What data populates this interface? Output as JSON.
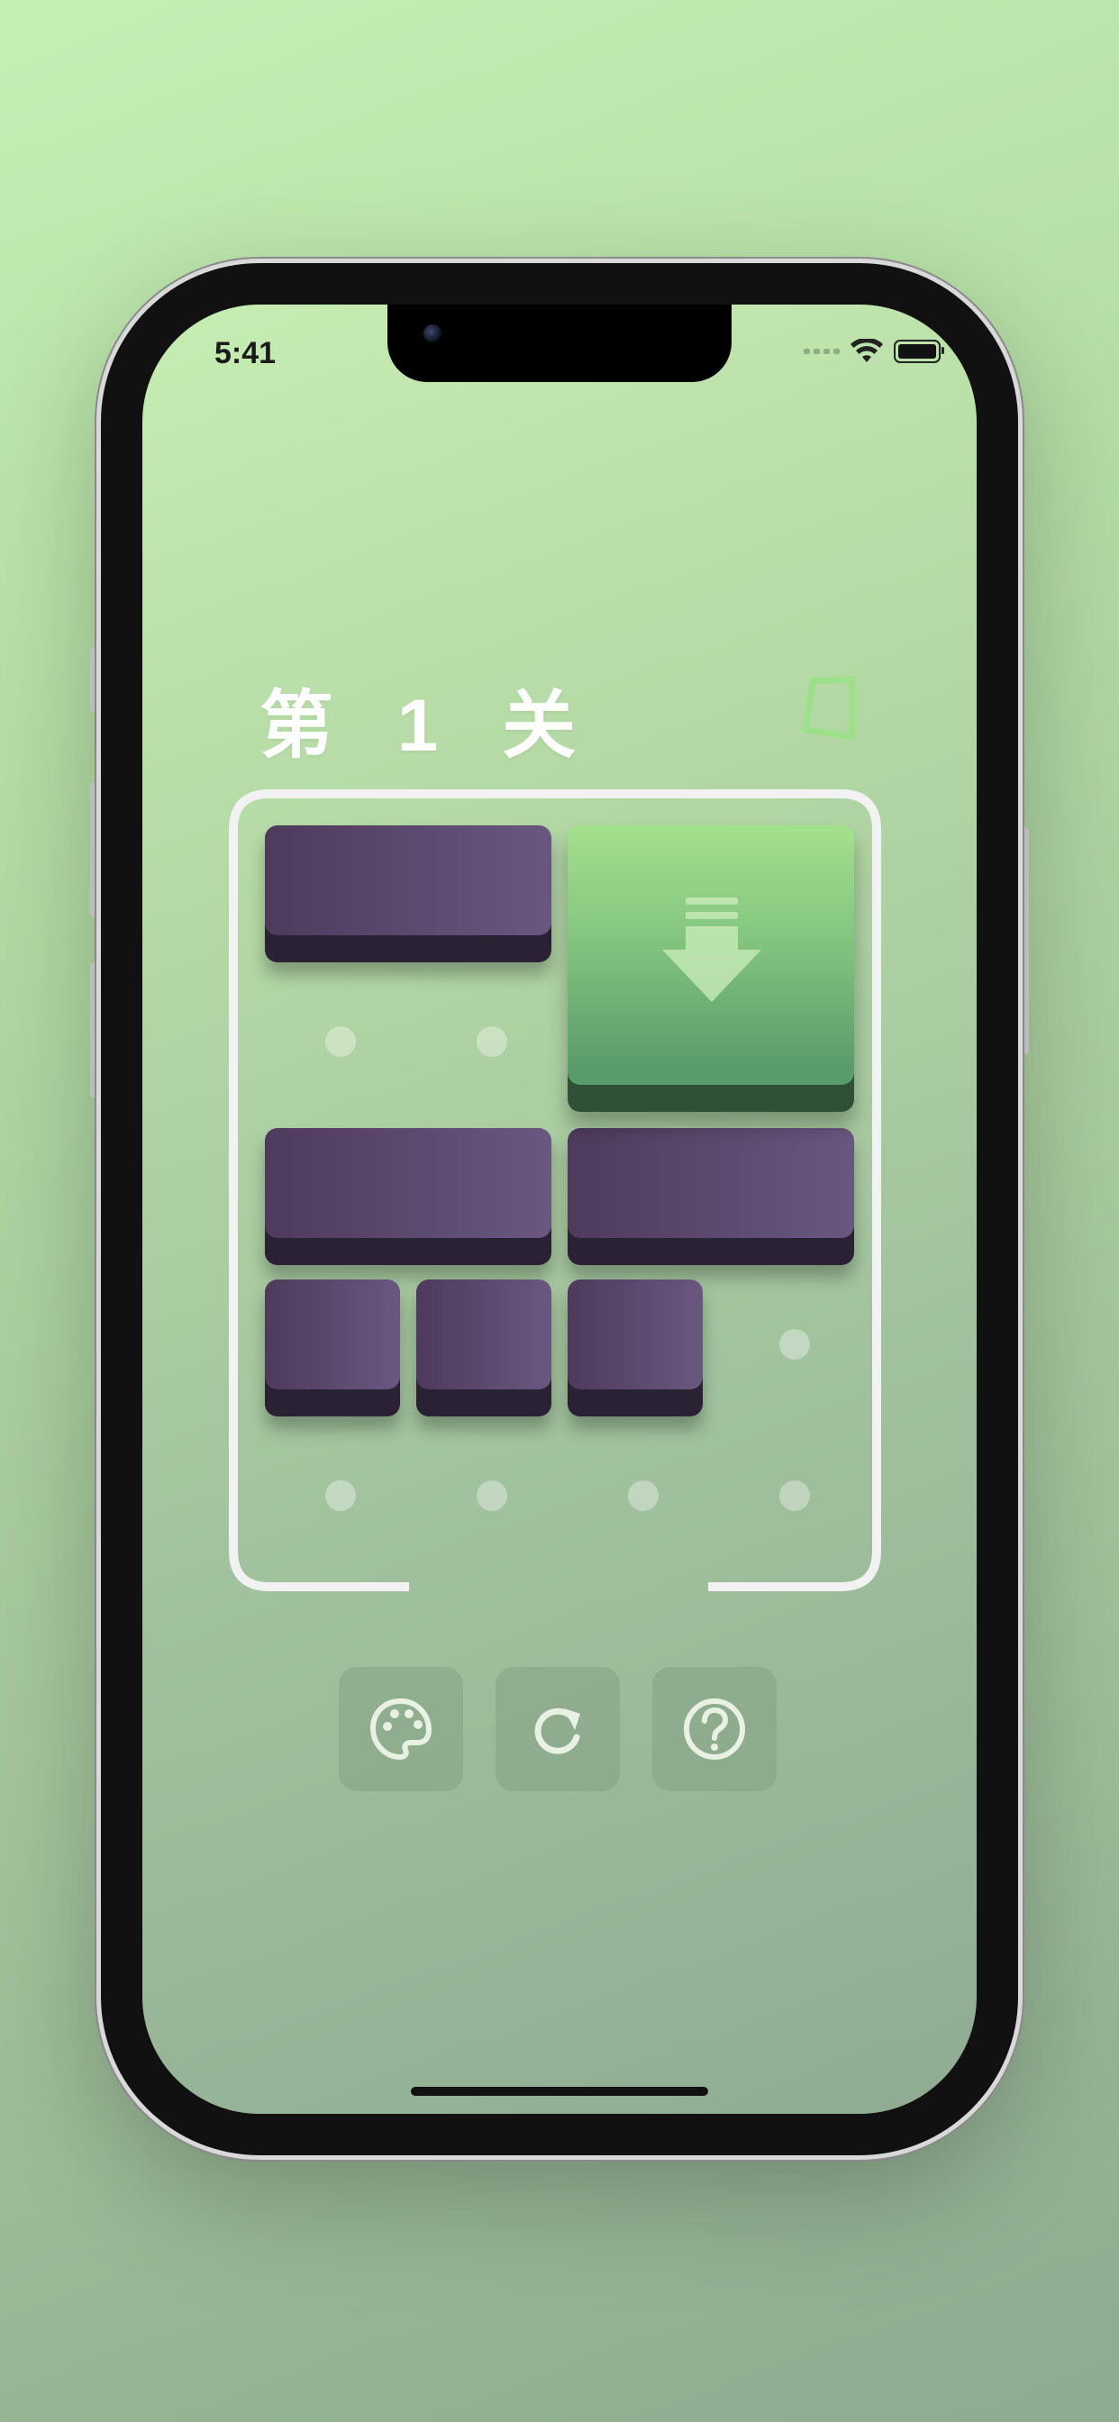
{
  "status_bar": {
    "time": "5:41"
  },
  "level": {
    "title": "第 1 关"
  },
  "icons": {
    "goal": "trapezoid-outline-icon",
    "goal_block": "down-arrow-icon",
    "theme": "palette-icon",
    "restart": "refresh-icon",
    "help": "question-circle-icon"
  },
  "colors": {
    "accent": "#8fd67f",
    "block": "#5b476c",
    "goal_block": "#8fcf81",
    "frame": "#f2f2f2"
  },
  "controls": [
    {
      "name": "theme-button",
      "icon": "palette-icon"
    },
    {
      "name": "restart-button",
      "icon": "refresh-icon"
    },
    {
      "name": "help-button",
      "icon": "question-circle-icon"
    }
  ]
}
